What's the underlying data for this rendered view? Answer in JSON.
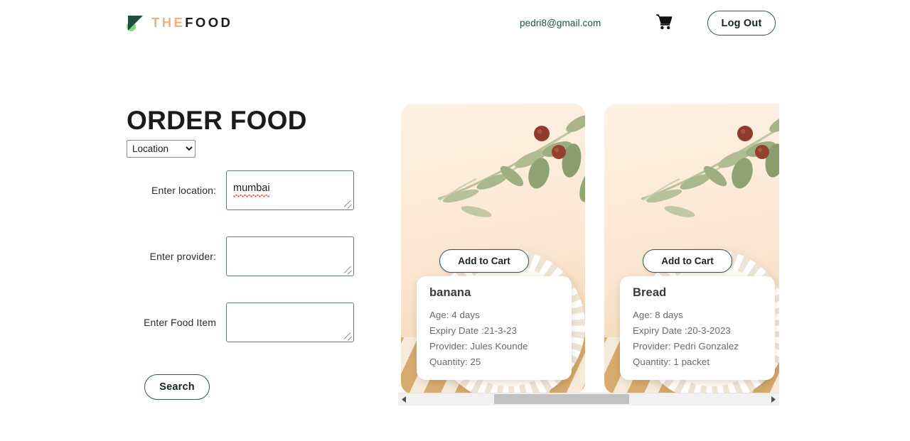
{
  "header": {
    "brand_the": "THE",
    "brand_food": "FOOD",
    "brand_mark_icon": "triangle-leaf-logo",
    "user_email": "pedri8@gmail.com",
    "cart_icon": "shopping-cart-icon",
    "logout_label": "Log Out"
  },
  "main": {
    "title": "ORDER FOOD",
    "location_select": {
      "selected": "Location",
      "options": [
        "Location"
      ]
    },
    "fields": [
      {
        "label": "Enter location:",
        "value": "mumbai",
        "placeholder": "",
        "misspelled": true
      },
      {
        "label": "Enter provider:",
        "value": "",
        "placeholder": "",
        "misspelled": false
      },
      {
        "label": "Enter Food Item",
        "value": "",
        "placeholder": "",
        "misspelled": false
      }
    ],
    "search_label": "Search"
  },
  "cards": [
    {
      "name": "banana",
      "add_to_cart_label": "Add to Cart",
      "age": "Age: 4 days",
      "expiry": "Expiry Date :21-3-23",
      "provider": "Provider: Jules Kounde",
      "quantity": "Quantity: 25"
    },
    {
      "name": "Bread",
      "add_to_cart_label": "Add to Cart",
      "age": "Age: 8 days",
      "expiry": "Expiry Date :20-3-2023",
      "provider": "Provider: Pedri Gonzalez",
      "quantity": "Quantity: 1 packet"
    }
  ],
  "scrollbar": {
    "left_arrow_icon": "chevron-left-icon",
    "right_arrow_icon": "chevron-right-icon"
  },
  "colors": {
    "brand_accent": "#f0b27a",
    "brand_dark": "#1f4f43",
    "logo_green": "#7ed97a",
    "button_border": "#2b5c4e",
    "card_bg": "#f8ddc0"
  }
}
